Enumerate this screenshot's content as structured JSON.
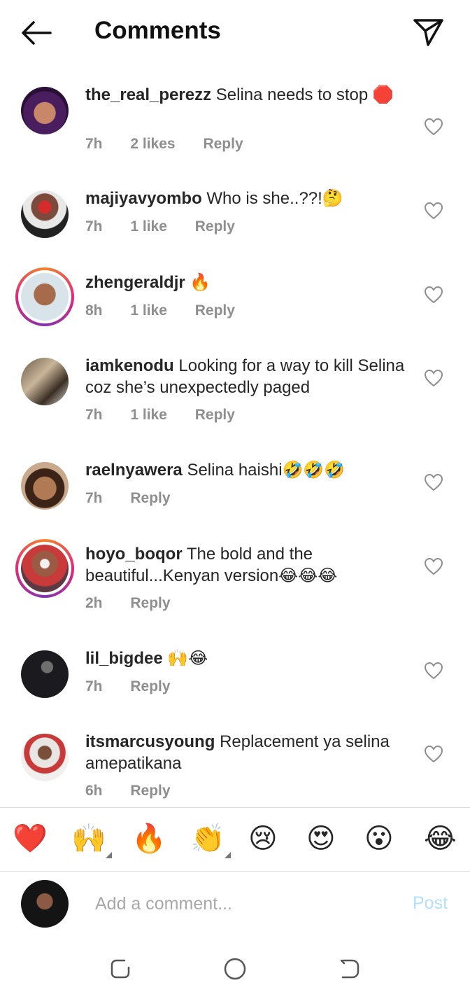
{
  "header": {
    "title": "Comments"
  },
  "comments": [
    {
      "username": "the_real_perezz",
      "text": "Selina needs to stop 🛑",
      "time": "7h",
      "likes": "2 likes",
      "reply": "Reply"
    },
    {
      "username": "majiyavyombo",
      "text": "Who is she..??!🤔",
      "time": "7h",
      "likes": "1 like",
      "reply": "Reply"
    },
    {
      "username": "zhengeraldjr",
      "text": "🔥",
      "time": "8h",
      "likes": "1 like",
      "reply": "Reply"
    },
    {
      "username": "iamkenodu",
      "text": "Looking for a way to kill Selina coz she’s unexpectedly paged",
      "time": "7h",
      "likes": "1 like",
      "reply": "Reply"
    },
    {
      "username": "raelnyawera",
      "text": "Selina haishi🤣🤣🤣",
      "time": "7h",
      "likes": "",
      "reply": "Reply"
    },
    {
      "username": "hoyo_boqor",
      "text": "The bold and the beautiful...Kenyan version😂😂😂",
      "time": "2h",
      "likes": "",
      "reply": "Reply"
    },
    {
      "username": "lil_bigdee",
      "text": "🙌😂",
      "time": "7h",
      "likes": "",
      "reply": "Reply"
    },
    {
      "username": "itsmarcusyoung",
      "text": "Replacement ya selina amepatikana",
      "time": "6h",
      "likes": "",
      "reply": "Reply"
    }
  ],
  "emoji_bar": [
    "❤️",
    "🙌",
    "🔥",
    "👏",
    "😢",
    "😍",
    "😮",
    "😂"
  ],
  "composer": {
    "placeholder": "Add a comment...",
    "post_label": "Post"
  },
  "colors": {
    "accent_disabled": "#b2dffc",
    "meta_gray": "#8e8e8e",
    "story_ring": "#dd2a7b"
  }
}
